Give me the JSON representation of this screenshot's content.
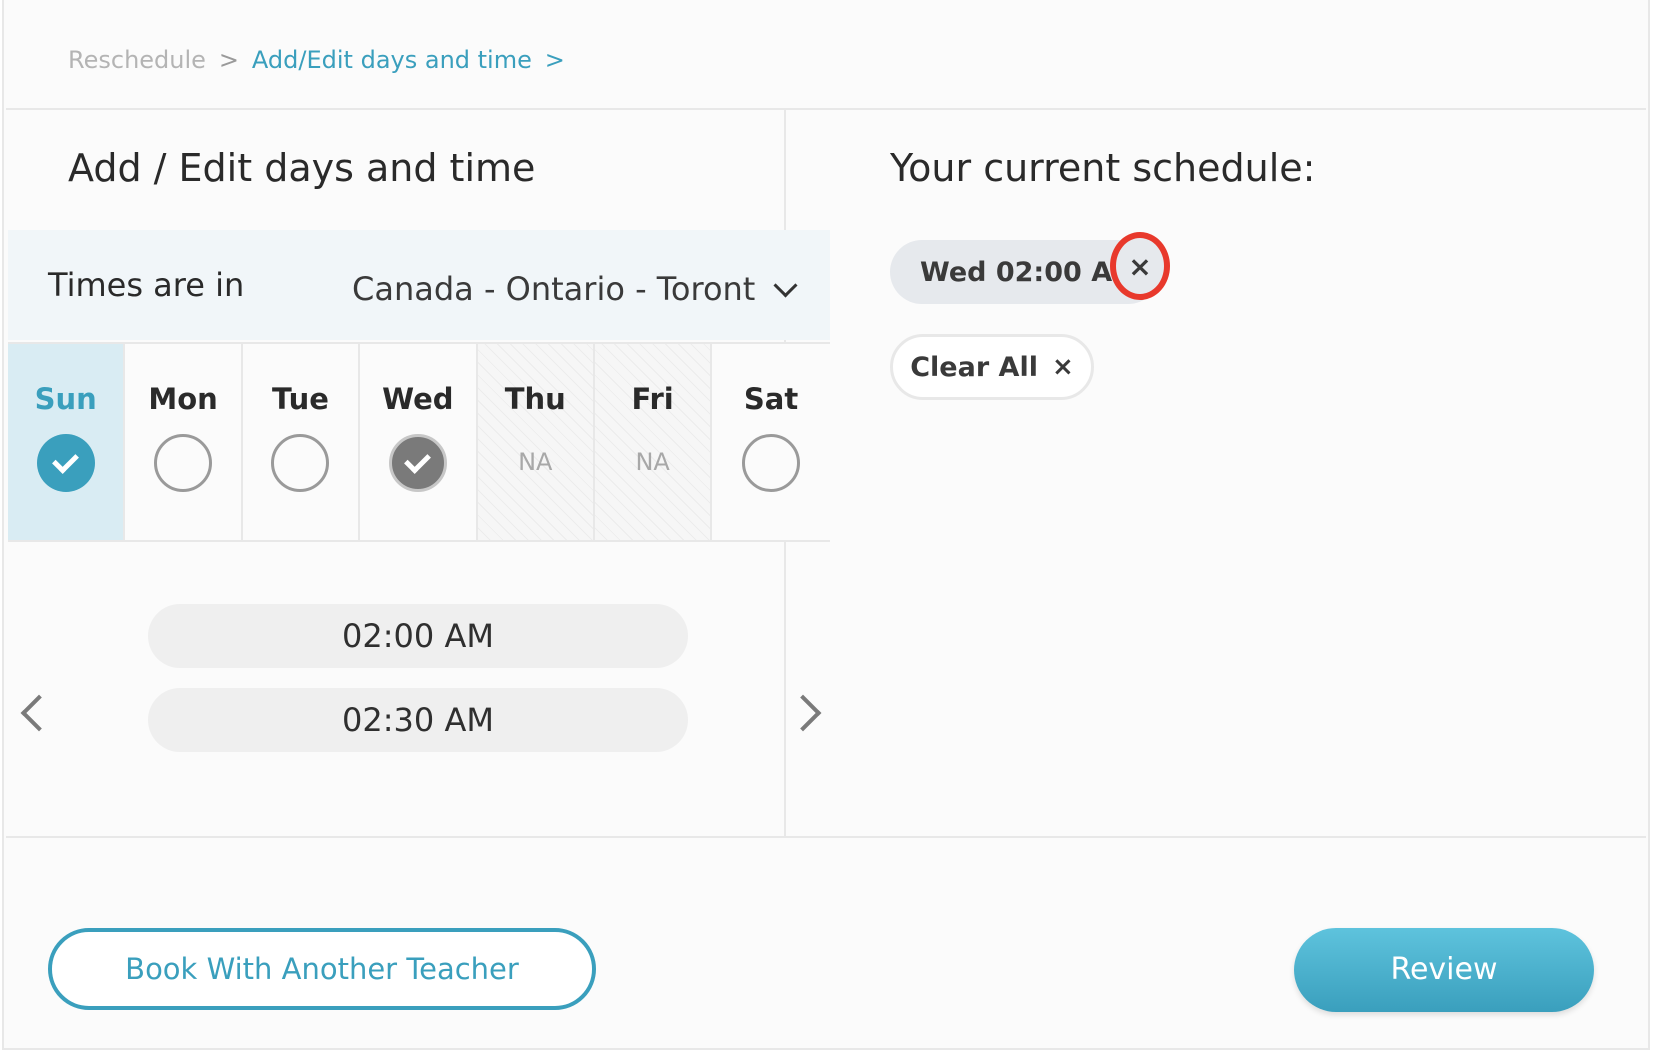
{
  "breadcrumb": {
    "items": [
      "Reschedule",
      "Add/Edit days and time"
    ],
    "separator": ">"
  },
  "left": {
    "title": "Add / Edit days and time",
    "timezone_label": "Times are in",
    "timezone_value": "Canada - Ontario - Toront",
    "days": [
      {
        "label": "Sun",
        "state": "selected"
      },
      {
        "label": "Mon",
        "state": "empty"
      },
      {
        "label": "Tue",
        "state": "empty"
      },
      {
        "label": "Wed",
        "state": "scheduled"
      },
      {
        "label": "Thu",
        "state": "na",
        "na_text": "NA"
      },
      {
        "label": "Fri",
        "state": "na",
        "na_text": "NA"
      },
      {
        "label": "Sat",
        "state": "empty"
      }
    ],
    "time_slots": [
      "02:00 AM",
      "02:30 AM"
    ]
  },
  "right": {
    "title": "Your current schedule:",
    "chips": [
      {
        "label": "Wed 02:00 AM",
        "remove_icon": "×"
      }
    ],
    "clear_all_label": "Clear All",
    "clear_all_icon": "×"
  },
  "footer": {
    "secondary_button": "Book With Another Teacher",
    "primary_button": "Review"
  },
  "colors": {
    "accent": "#3a9fbd",
    "highlight_ring": "#e8392c",
    "selected_day_bg": "#d9ecf3"
  }
}
